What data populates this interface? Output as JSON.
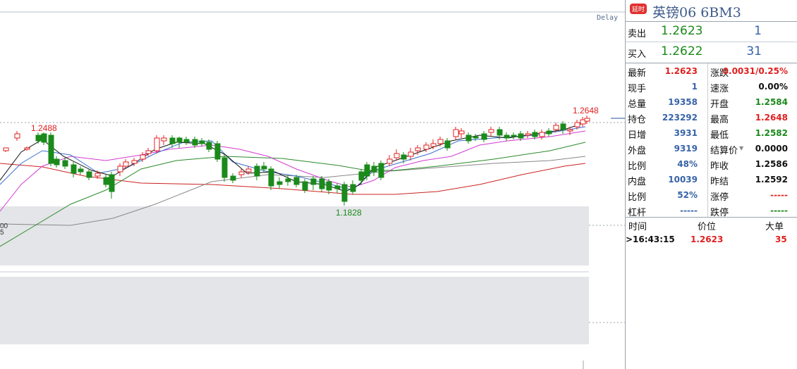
{
  "chart": {
    "delay_label": "Delay",
    "high_label": "1.2648",
    "left_high_label": "1.2488",
    "low_label": "1.1828",
    "left_axis_fragments": [
      "00",
      "5"
    ]
  },
  "header": {
    "badge": "延时",
    "title": "英镑06  6BM3"
  },
  "quote": {
    "sell": {
      "label": "卖出",
      "price": "1.2623",
      "volume": "1"
    },
    "buy": {
      "label": "买入",
      "price": "1.2622",
      "volume": "31"
    }
  },
  "stats_left": [
    {
      "label": "最新",
      "value": "1.2623",
      "color": "red"
    },
    {
      "label": "现手",
      "value": "1",
      "color": "blue"
    },
    {
      "label": "总量",
      "value": "19358",
      "color": "blue"
    },
    {
      "label": "持仓",
      "value": "223292",
      "color": "blue"
    },
    {
      "label": "日增",
      "value": "3931",
      "color": "blue"
    },
    {
      "label": "外盘",
      "value": "9319",
      "color": "blue"
    },
    {
      "label": "比例",
      "value": "48%",
      "color": "blue"
    },
    {
      "label": "内盘",
      "value": "10039",
      "color": "blue"
    },
    {
      "label": "比例",
      "value": "52%",
      "color": "blue"
    },
    {
      "label": "杠杆",
      "value": "-----",
      "color": "blue"
    }
  ],
  "stats_right": [
    {
      "label": "涨跌",
      "value": "0.0031/0.25%",
      "color": "red"
    },
    {
      "label": "速涨",
      "value": "0.00%",
      "color": "black"
    },
    {
      "label": "开盘",
      "value": "1.2584",
      "color": "green"
    },
    {
      "label": "最高",
      "value": "1.2648",
      "color": "red"
    },
    {
      "label": "最低",
      "value": "1.2582",
      "color": "green"
    },
    {
      "label": "结算价",
      "value": "0.0000",
      "color": "black"
    },
    {
      "label": "昨收",
      "value": "1.2586",
      "color": "black"
    },
    {
      "label": "昨结",
      "value": "1.2592",
      "color": "black"
    },
    {
      "label": "涨停",
      "value": "-----",
      "color": "red"
    },
    {
      "label": "跌停",
      "value": "-----",
      "color": "green"
    }
  ],
  "ticks": {
    "headers": [
      "时间",
      "价位",
      "大单"
    ],
    "rows": [
      {
        "time": ">16:43:15",
        "price": "1.2623",
        "size": "35"
      }
    ]
  },
  "colors": {
    "up": "#e02020",
    "down": "#1a8a1a",
    "ma5": "#111111",
    "ma10": "#3b6fd0",
    "ma20": "#d23bd2",
    "ma30": "#2a8a2a",
    "ma60": "#888888",
    "ma120": "#cc2222"
  }
}
